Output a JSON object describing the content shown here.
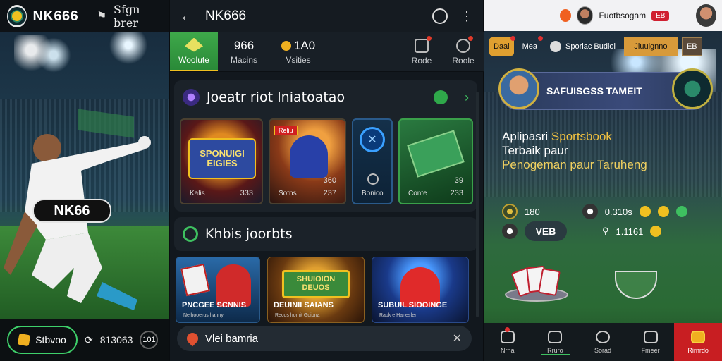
{
  "left": {
    "brand": "NK666",
    "sign_label": "Sfgn brer",
    "badge": "NK66",
    "bottom": {
      "pill_label": "Stbvoo",
      "refresh_value": "813063",
      "round_btn": "101"
    }
  },
  "middle": {
    "title": "NK666",
    "stats": [
      {
        "value": "",
        "label": "Woolute"
      },
      {
        "value": "966",
        "label": "Macins"
      },
      {
        "value": "1A0",
        "label": "Vsities"
      },
      {
        "value": "",
        "label": "Rode"
      },
      {
        "value": "",
        "label": "Roole"
      }
    ],
    "section1": {
      "title": "Joeatr riot Iniatoatao",
      "cards": [
        {
          "art": "SPONUIGI EIGIES",
          "label": "Kalis",
          "num": "333"
        },
        {
          "tag": "Reliu",
          "label": "Sotns",
          "num_top": "360",
          "num": "237"
        },
        {
          "label": "Bonico"
        },
        {
          "label": "Conte",
          "num_top": "39",
          "num": "233"
        }
      ]
    },
    "section2": {
      "title": "Khbis joorbts",
      "cards": [
        {
          "title": "PNCGEE SCNNIS",
          "sub": "Nelhooerus hanny"
        },
        {
          "art": "SHUIOION DEUOS",
          "title": "DEUINII SAIANS",
          "sub": "Recos homit Guiona"
        },
        {
          "title": "SUBUIL SIOOINGE",
          "sub": "Rauk e Hanesfer"
        }
      ]
    },
    "bottom_bar": "Vlei bamria"
  },
  "right": {
    "top": {
      "name": "Fuotbsogam",
      "badge": "EB"
    },
    "tabs": [
      "Daai",
      "Mea",
      "Sporiac Budiol",
      "Jiuuignno",
      "EB"
    ],
    "tourney": "SAFUISGSS TAMEIT",
    "headline": {
      "line1_a": "Aplipasri ",
      "line1_b": "Sportsbook",
      "line2": "Terbaik paur",
      "line3": "Penogeman paur Taruheng"
    },
    "odds": {
      "r1_value": "180",
      "r1_value2": "0.310s",
      "r2_value": "VEB",
      "r2_value2": "1.1161"
    },
    "bottom_nav": [
      "Nrna",
      "Rruro",
      "Sorad",
      "Fmeer",
      "Rirnrdo"
    ]
  }
}
